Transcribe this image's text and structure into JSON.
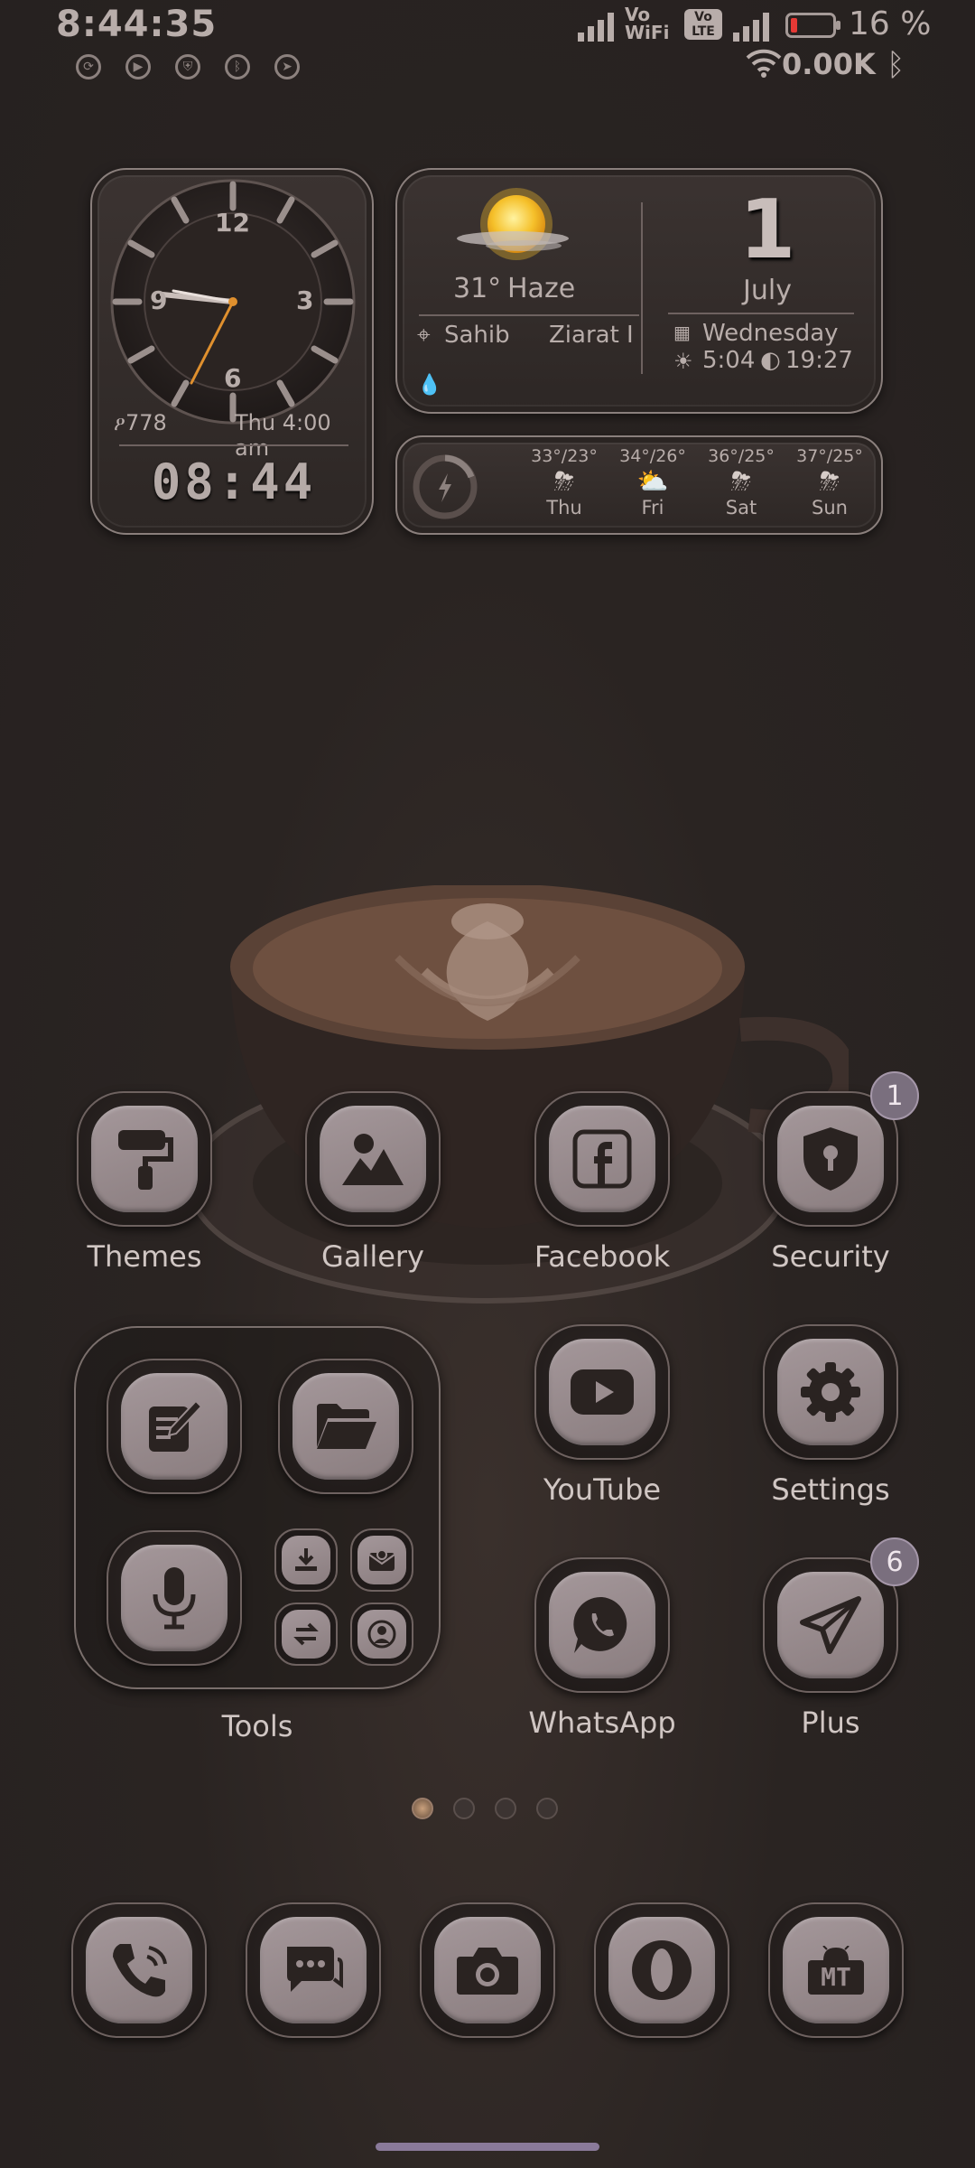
{
  "status_bar": {
    "time": "8:44:35",
    "wifi_label_top": "Vo",
    "wifi_label_bottom": "WiFi",
    "volte_label": "Vo LTE",
    "battery_percent": "16 %",
    "battery_level": 0.16,
    "net_speed": "0.00K",
    "notification_icons": [
      "sync-icon",
      "play-icon",
      "shield-icon",
      "bluetooth-icon",
      "telegram-icon"
    ]
  },
  "clock_widget": {
    "numerals": [
      "12",
      "3",
      "6",
      "9"
    ],
    "steps": "778",
    "alarm": "Thu 4:00 am",
    "digital_time": "08:44"
  },
  "weather_widget": {
    "temperature": "31°",
    "condition": "Haze",
    "location_1": "Sahib",
    "location_2": "Ziarat I",
    "date_day": "1",
    "month": "July",
    "weekday": "Wednesday",
    "sunrise": "5:04",
    "sunset": "19:27"
  },
  "forecast_widget": {
    "days": [
      {
        "temps": "33°/23°",
        "day": "Thu"
      },
      {
        "temps": "34°/26°",
        "day": "Fri"
      },
      {
        "temps": "36°/25°",
        "day": "Sat"
      },
      {
        "temps": "37°/25°",
        "day": "Sun"
      }
    ]
  },
  "apps": {
    "themes": "Themes",
    "gallery": "Gallery",
    "facebook": "Facebook",
    "security": "Security",
    "security_badge": "1",
    "youtube": "YouTube",
    "settings": "Settings",
    "whatsapp": "WhatsApp",
    "plus": "Plus",
    "plus_badge": "6",
    "tools_folder": "Tools"
  },
  "dock": [
    "phone-icon",
    "messages-icon",
    "camera-icon",
    "opera-icon",
    "mt-manager-icon"
  ],
  "dock_mt_label": "MT",
  "pages": {
    "count": 4,
    "active": 0
  },
  "colors": {
    "accent": "#a4979a",
    "badge": "#7a6f7e",
    "battery_low": "#e53935",
    "hand": "#e0902e"
  }
}
